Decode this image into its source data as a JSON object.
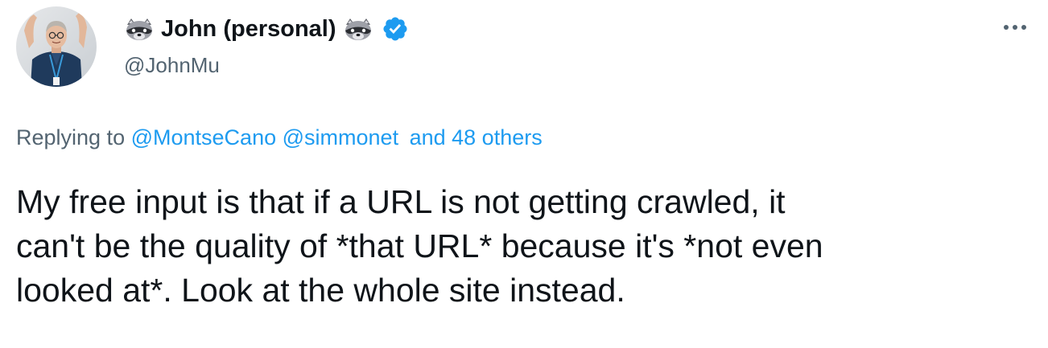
{
  "author": {
    "display_name": "John (personal)",
    "handle": "@JohnMu",
    "verified": true,
    "name_emoji": "raccoon-emoji"
  },
  "menu": {
    "icon": "more-horizontal-icon"
  },
  "reply_context": {
    "prefix": "Replying to",
    "mentions": [
      "@MontseCano",
      "@simmonet"
    ],
    "others": "and 48 others"
  },
  "tweet": {
    "text_lines": [
      "My free input is that if a URL is not getting crawled, it",
      "can't be the quality of *that URL* because it's *not even",
      "looked at*. Look at the whole site instead."
    ]
  },
  "colors": {
    "link": "#1d9bf0",
    "secondary_text": "#536471",
    "primary_text": "#0f1419",
    "verified_badge": "#1d9bf0"
  }
}
